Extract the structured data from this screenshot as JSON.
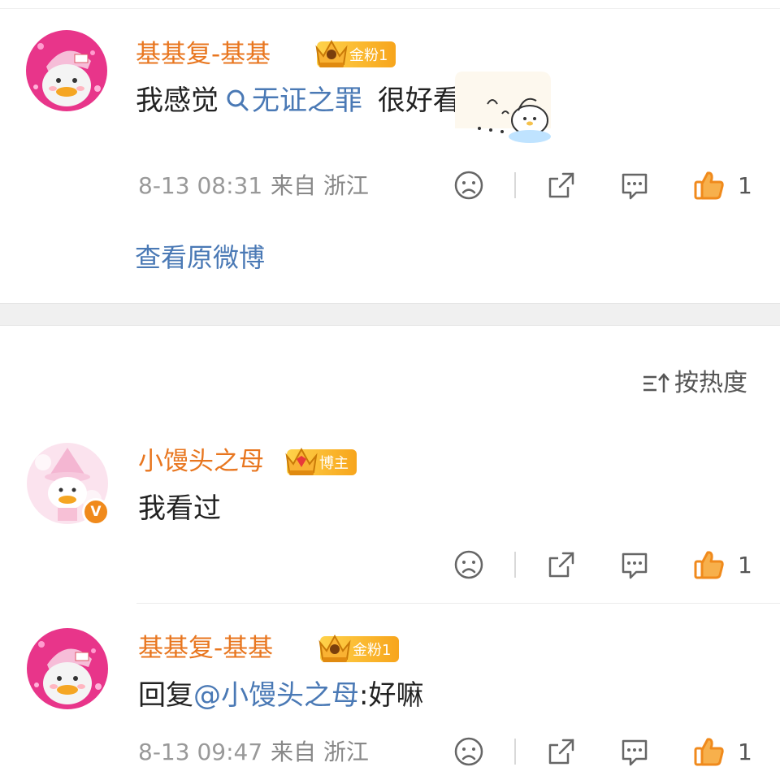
{
  "post": {
    "comment1": {
      "username": "基基复-基基",
      "badge": "金粉1",
      "text_prefix": "我感觉",
      "topic": "无证之罪",
      "text_suffix": "很好看",
      "time": "8-13 08:31",
      "source": "来自 浙江",
      "like_count": "1"
    },
    "view_original": "查看原微博"
  },
  "sort": {
    "label": "按热度"
  },
  "comments": [
    {
      "username": "小馒头之母",
      "badge": "博主",
      "text": "我看过",
      "like_count": "1",
      "verified": "V"
    },
    {
      "username": "基基复-基基",
      "badge": "金粉1",
      "reply_prefix": "回复",
      "mention": "@小馒头之母",
      "reply_text": ":好嘛",
      "time": "8-13 09:47",
      "source": "来自 浙江",
      "like_count": "1"
    }
  ],
  "colors": {
    "username": "#e8761f",
    "link": "#4a79b5",
    "like": "#f08a1c",
    "badge": "#f7a51c"
  },
  "icons": [
    "sad-face-icon",
    "share-icon",
    "comment-icon",
    "like-icon",
    "sort-icon",
    "search-icon",
    "crown-icon",
    "verified-icon"
  ]
}
